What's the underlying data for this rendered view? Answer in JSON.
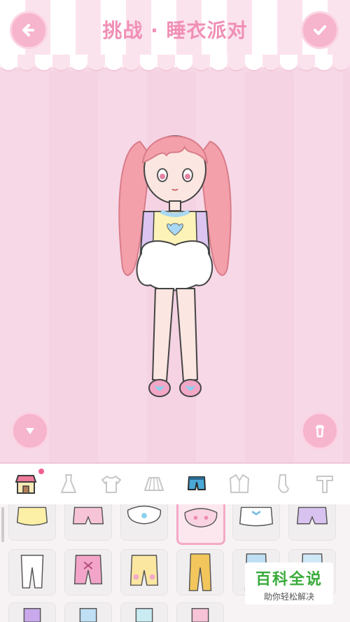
{
  "header": {
    "title": "挑战 · 睡衣派对"
  },
  "buttons": {
    "back": "back-arrow-icon",
    "confirm": "checkmark-icon",
    "collapse": "triangle-down-icon",
    "trash": "trash-icon"
  },
  "tabs": [
    {
      "name": "shop",
      "icon": "shop-icon",
      "badge": true
    },
    {
      "name": "dress",
      "icon": "dress-icon"
    },
    {
      "name": "shirt",
      "icon": "tshirt-icon"
    },
    {
      "name": "skirt",
      "icon": "skirt-icon"
    },
    {
      "name": "shorts",
      "icon": "shorts-icon",
      "selected": true
    },
    {
      "name": "jacket",
      "icon": "jacket-icon"
    },
    {
      "name": "socks",
      "icon": "sock-icon"
    },
    {
      "name": "more",
      "icon": "t-icon"
    }
  ],
  "items": [
    {
      "icon": "yellow-shorts-icon"
    },
    {
      "icon": "pink-shorts-icon"
    },
    {
      "icon": "heart-bloomers-icon"
    },
    {
      "icon": "bow-bloomers-icon",
      "selected": true
    },
    {
      "icon": "blue-bow-shorts-icon"
    },
    {
      "icon": "lilac-shorts-icon"
    },
    {
      "icon": "white-pants-icon"
    },
    {
      "icon": "pink-cross-pants-icon"
    },
    {
      "icon": "yellow-heart-pants-icon"
    },
    {
      "icon": "mustard-pants-icon"
    },
    {
      "icon": "blue-pants-icon"
    },
    {
      "icon": "stripe-pants-icon"
    }
  ],
  "watermark": {
    "title": "百科全说",
    "subtitle": "助你轻松解决"
  },
  "colors": {
    "accent": "#f7b4cd",
    "title": "#f08fb5",
    "background": "#f6d7e6"
  }
}
